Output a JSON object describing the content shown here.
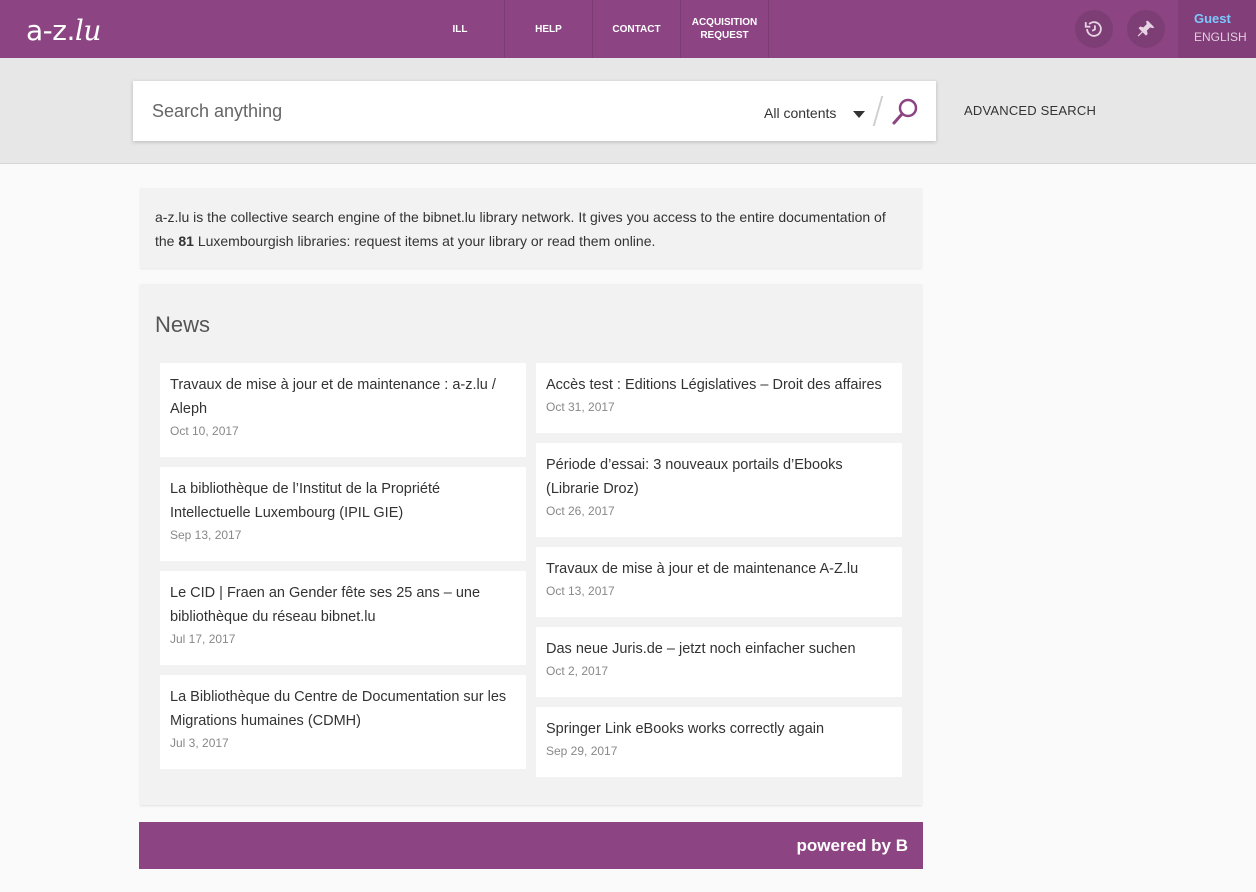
{
  "header": {
    "logo_main": "a-z.",
    "logo_lu": "lu",
    "nav": [
      {
        "line1": "ILL",
        "line2": ""
      },
      {
        "line1": "HELP",
        "line2": ""
      },
      {
        "line1": "CONTACT",
        "line2": ""
      },
      {
        "line1": "ACQUISITION",
        "line2": "REQUEST"
      }
    ],
    "user": "Guest",
    "language": "ENGLISH",
    "icons": [
      "history-icon",
      "pin-icon"
    ]
  },
  "search": {
    "placeholder": "Search anything",
    "scope": "All contents",
    "advanced": "ADVANCED SEARCH"
  },
  "intro": {
    "before": "a-z.lu is the collective search engine of the bibnet.lu library network. It gives you access to the entire documentation of the ",
    "count": "81",
    "after": " Luxembourgish libraries: request items at your library or read them online."
  },
  "news": {
    "title": "News",
    "left": [
      {
        "title": "Travaux de mise à jour et de maintenance : a-z.lu / Aleph",
        "date": "Oct 10, 2017"
      },
      {
        "title": "La bibliothèque de l’Institut de la Propriété Intellectuelle Luxembourg (IPIL GIE)",
        "date": "Sep 13, 2017"
      },
      {
        "title": "Le CID | Fraen an Gender fête ses 25 ans – une bibliothèque du réseau bibnet.lu",
        "date": "Jul 17, 2017"
      },
      {
        "title": "La Bibliothèque du Centre de Documentation sur les Migrations humaines (CDMH)",
        "date": "Jul 3, 2017"
      }
    ],
    "right": [
      {
        "title": "Accès test : Editions Législatives – Droit des affaires",
        "date": "Oct 31, 2017"
      },
      {
        "title": "Période d’essai: 3 nouveaux portails d’Ebooks (Librarie Droz)",
        "date": "Oct 26, 2017"
      },
      {
        "title": "Travaux de mise à jour et de maintenance A-Z.lu",
        "date": "Oct 13, 2017"
      },
      {
        "title": "Das neue Juris.de – jetzt noch einfacher suchen",
        "date": "Oct 2, 2017"
      },
      {
        "title": "Springer Link eBooks works correctly again",
        "date": "Sep 29, 2017"
      }
    ]
  },
  "footer": {
    "powered": "powered by",
    "brand_glyph": "B"
  }
}
